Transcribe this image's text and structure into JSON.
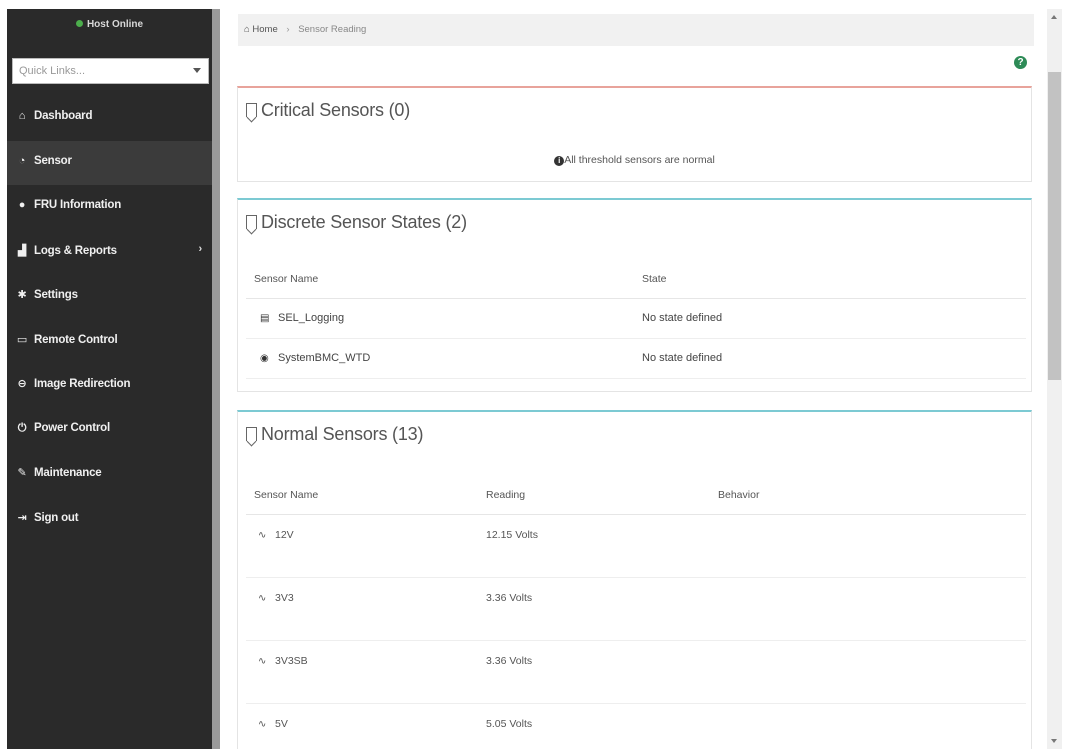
{
  "sidebar": {
    "host_status": "Host Online",
    "quick_links_placeholder": "Quick Links...",
    "items": [
      {
        "label": "Dashboard",
        "icon": "home-icon"
      },
      {
        "label": "Sensor",
        "icon": "tachometer-icon"
      },
      {
        "label": "FRU Information",
        "icon": "info-icon"
      },
      {
        "label": "Logs & Reports",
        "icon": "bar-chart-icon"
      },
      {
        "label": "Settings",
        "icon": "gear-icon"
      },
      {
        "label": "Remote Control",
        "icon": "monitor-icon"
      },
      {
        "label": "Image Redirection",
        "icon": "disc-icon"
      },
      {
        "label": "Power Control",
        "icon": "power-icon"
      },
      {
        "label": "Maintenance",
        "icon": "wrench-icon"
      },
      {
        "label": "Sign out",
        "icon": "sign-out-icon"
      }
    ]
  },
  "breadcrumb": {
    "home": "Home",
    "current": "Sensor Reading"
  },
  "critical": {
    "title": "Critical Sensors (0)",
    "message": "All threshold sensors are normal"
  },
  "discrete": {
    "title": "Discrete Sensor States (2)",
    "headers": {
      "name": "Sensor Name",
      "state": "State"
    },
    "rows": [
      {
        "name": "SEL_Logging",
        "state": "No state defined",
        "icon": "log-icon"
      },
      {
        "name": "SystemBMC_WTD",
        "state": "No state defined",
        "icon": "eye-icon"
      }
    ]
  },
  "normal": {
    "title": "Normal Sensors (13)",
    "headers": {
      "name": "Sensor Name",
      "reading": "Reading",
      "behavior": "Behavior"
    },
    "rows": [
      {
        "name": "12V",
        "reading": "12.15 Volts",
        "icon": "voltage-icon"
      },
      {
        "name": "3V3",
        "reading": "3.36 Volts",
        "icon": "voltage-icon"
      },
      {
        "name": "3V3SB",
        "reading": "3.36 Volts",
        "icon": "voltage-icon"
      },
      {
        "name": "5V",
        "reading": "5.05 Volts",
        "icon": "voltage-icon"
      }
    ]
  },
  "colors": {
    "sidebar_bg": "#2a2a2a",
    "active_item_bg": "#3b3b3b",
    "critical_accent": "#e8a39b",
    "normal_accent": "#7ccad3",
    "online_indicator": "#4cae4c",
    "help_icon": "#2e8b57"
  }
}
